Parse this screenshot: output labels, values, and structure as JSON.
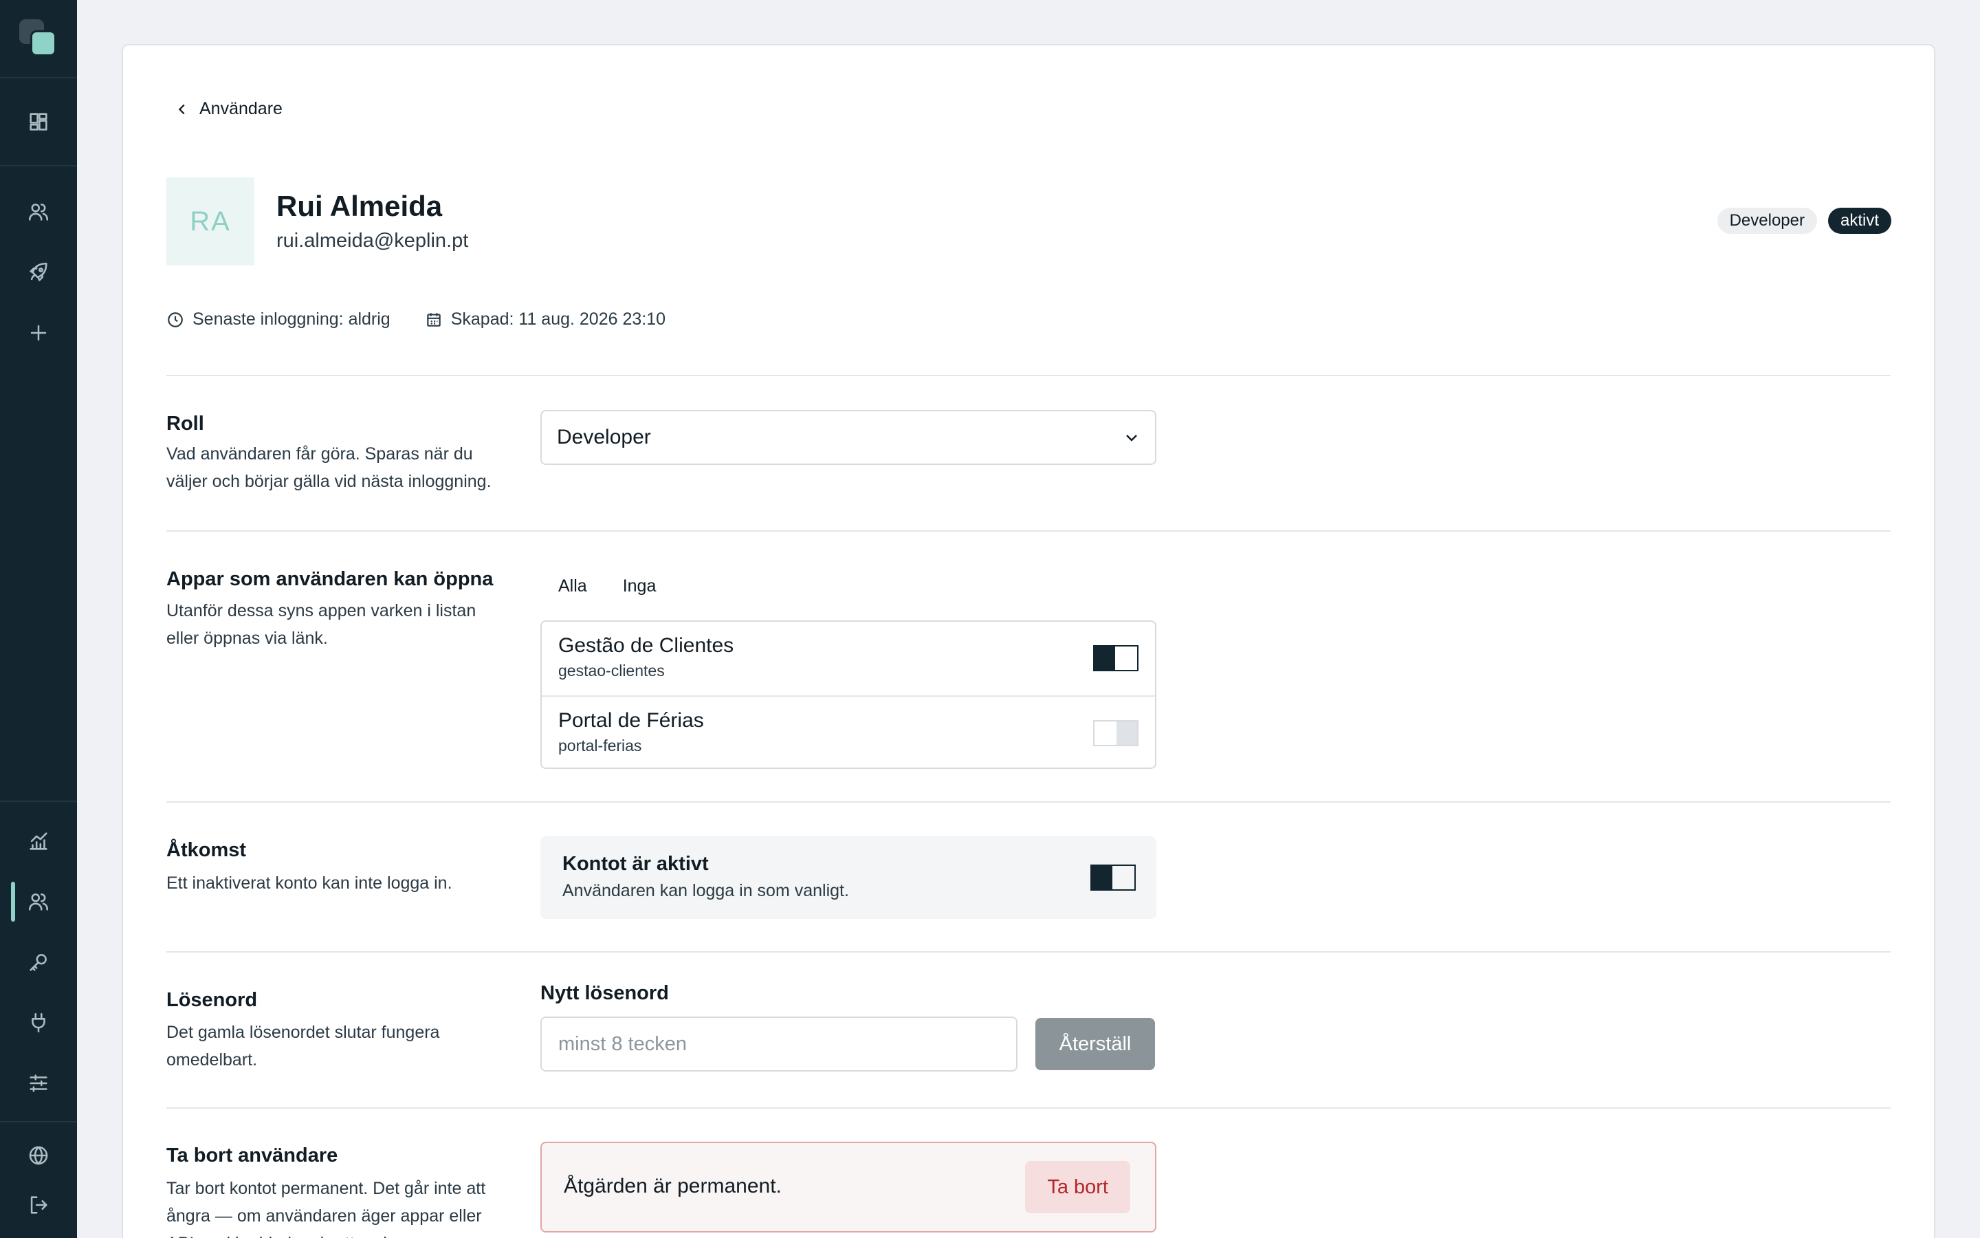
{
  "sidebar": {
    "top_icons": [
      "dashboard-icon",
      "users-icon",
      "rocket-icon",
      "plus-icon"
    ],
    "bottom_icons": [
      "analytics-icon",
      "users-icon",
      "key-icon",
      "plug-icon",
      "sliders-icon"
    ],
    "footer_icons": [
      "globe-icon",
      "logout-icon"
    ],
    "active_item": "users",
    "accent_color": "#8fd3c8"
  },
  "breadcrumb": {
    "back_label": "Användare"
  },
  "user": {
    "initials": "RA",
    "name": "Rui Almeida",
    "email": "rui.almeida@keplin.pt",
    "role_badge": "Developer",
    "status_badge": "aktivt",
    "last_login": "Senaste inloggning: aldrig",
    "created": "Skapad: 11 aug. 2026 23:10"
  },
  "role_section": {
    "title": "Roll",
    "description": "Vad användaren får göra. Sparas när du väljer och börjar gälla vid nästa inloggning.",
    "selected": "Developer"
  },
  "apps_section": {
    "title": "Appar som användaren kan öppna",
    "description": "Utanför dessa syns appen varken i listan eller öppnas via länk.",
    "tab_all": "Alla",
    "tab_none": "Inga",
    "apps": [
      {
        "name": "Gestão de Clientes",
        "slug": "gestao-clientes",
        "enabled": true
      },
      {
        "name": "Portal de Férias",
        "slug": "portal-ferias",
        "enabled": false
      }
    ]
  },
  "access_section": {
    "title": "Åtkomst",
    "description": "Ett inaktiverat konto kan inte logga in.",
    "box_title": "Kontot är aktivt",
    "box_sub": "Användaren kan logga in som vanligt.",
    "enabled": true
  },
  "password_section": {
    "title": "Lösenord",
    "description": "Det gamla lösenordet slutar fungera omedelbart.",
    "label": "Nytt lösenord",
    "placeholder": "minst 8 tecken",
    "button": "Återställ"
  },
  "delete_section": {
    "title": "Ta bort användare",
    "description": "Tar bort kontot permanent. Det går inte att ångra — om användaren äger appar eller API-nycklar hindras borttagningen.",
    "warning": "Åtgärden är permanent.",
    "button": "Ta bort",
    "danger_color": "#b3252a"
  }
}
